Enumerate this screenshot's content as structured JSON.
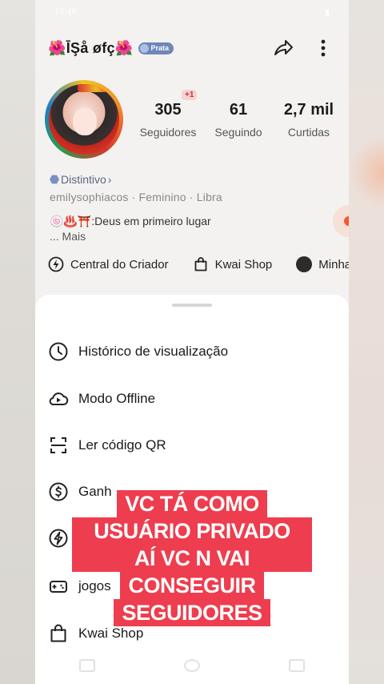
{
  "status_bar": {
    "time": "14:46",
    "battery": ""
  },
  "header": {
    "username": "🌺ĪŞå øfç🌺",
    "badge": "Prata"
  },
  "stats": [
    {
      "value": "305",
      "label": "Seguidores"
    },
    {
      "value": "61",
      "label": "Seguindo"
    },
    {
      "value": "2,7 mil",
      "label": "Curtidas"
    }
  ],
  "new_followers": "+1",
  "profile": {
    "distintivo": "Distintivo",
    "meta": "emilysophiacos · Feminino · Libra",
    "bio": "🍥♨️⛩️:Deus em primeiro lugar",
    "more": "...  Mais"
  },
  "quick_links": [
    {
      "label": "Central do Criador",
      "icon": "lightning-icon"
    },
    {
      "label": "Kwai Shop",
      "icon": "shopping-bag-icon"
    },
    {
      "label": "Minha",
      "icon": "avatar"
    }
  ],
  "menu": [
    {
      "label": "Histórico de visualização",
      "icon": "clock-icon"
    },
    {
      "label": "Modo Offline",
      "icon": "cloud-play-icon"
    },
    {
      "label": "Ler código QR",
      "icon": "qr-scan-icon"
    },
    {
      "label": "Ganh",
      "icon": "dollar-icon"
    },
    {
      "label": "",
      "icon": "lightning-icon"
    },
    {
      "label": "jogos",
      "icon": "gamepad-icon"
    },
    {
      "label": "Kwai Shop",
      "icon": "shopping-bag-icon"
    }
  ],
  "caption": [
    "VC TÁ COMO",
    "USUÁRIO PRIVADO 🙁",
    "AÍ VC N VAI",
    "CONSEGUIR",
    "SEGUIDORES"
  ],
  "colors": {
    "caption_bg": "#ee3d4e",
    "badge": "#6f86b8",
    "accent": "#e0262e"
  }
}
